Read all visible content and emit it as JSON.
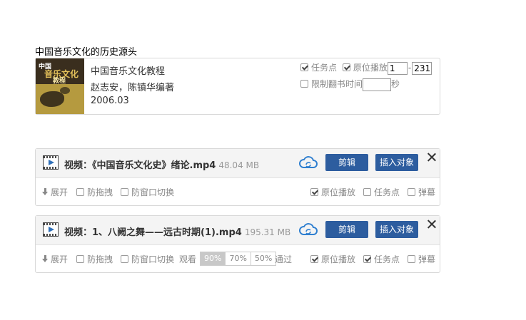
{
  "section_title": "中国音乐文化的历史源头",
  "book": {
    "cover_text": [
      "中国",
      "音乐文化",
      "教程"
    ],
    "title": "中国音乐文化教程",
    "authors": "赵志安，陈镇华编著",
    "date": "2006.03",
    "options": {
      "task_point_label": "任务点",
      "task_point_checked": true,
      "inplace_play_label": "原位播放",
      "inplace_play_checked": true,
      "page_from": "1",
      "page_to": "231",
      "limit_label": "限制翻书时间",
      "limit_checked": false,
      "limit_value": "",
      "limit_unit": "秒"
    }
  },
  "videos": [
    {
      "title": "视频：《中国音乐文化史》绪论.mp4",
      "size": "48.04 MB",
      "edit_label": "剪辑",
      "insert_label": "插入对象",
      "expand_label": "展开",
      "anti_drag_label": "防拖拽",
      "anti_drag_checked": false,
      "anti_switch_label": "防窗口切换",
      "anti_switch_checked": false,
      "inplace_label": "原位播放",
      "inplace_checked": true,
      "task_label": "任务点",
      "task_checked": false,
      "danmu_label": "弹幕",
      "danmu_checked": false
    },
    {
      "title": "视频：1、八阙之舞——远古时期(1).mp4",
      "size": "195.31 MB",
      "edit_label": "剪辑",
      "insert_label": "插入对象",
      "expand_label": "展开",
      "anti_drag_label": "防拖拽",
      "anti_drag_checked": false,
      "anti_switch_label": "防窗口切换",
      "anti_switch_checked": false,
      "watch_label": "观看",
      "rates": [
        "90%",
        "70%",
        "50%"
      ],
      "active_rate": "90%",
      "pass_label": "通过",
      "inplace_label": "原位播放",
      "inplace_checked": true,
      "task_label": "任务点",
      "task_checked": true,
      "danmu_label": "弹幕",
      "danmu_checked": false
    }
  ],
  "colors": {
    "button_blue": "#2d5d9f",
    "cloud_blue": "#2f7fd0"
  },
  "icons": [
    "video-film-icon",
    "cloud-sync-icon",
    "close-icon",
    "expand-arrow-icon",
    "checkbox-icon"
  ]
}
